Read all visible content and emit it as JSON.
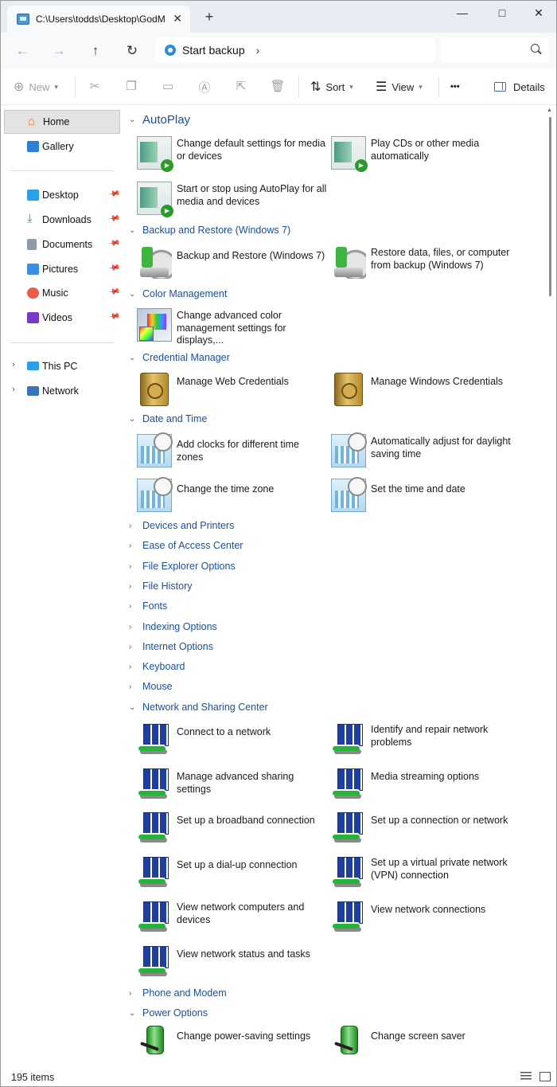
{
  "window": {
    "tab_title": "C:\\Users\\todds\\Desktop\\GodM",
    "minimize_glyph": "—",
    "maximize_glyph": "□",
    "close_glyph": "✕"
  },
  "address": {
    "location": "Start backup",
    "search_placeholder": ""
  },
  "commands": {
    "new_label": "New",
    "sort_label": "Sort",
    "view_label": "View",
    "more_label": "•••",
    "details_label": "Details"
  },
  "sidebar": {
    "items": [
      {
        "label": "Home"
      },
      {
        "label": "Gallery"
      },
      {
        "label": "Desktop"
      },
      {
        "label": "Downloads"
      },
      {
        "label": "Documents"
      },
      {
        "label": "Pictures"
      },
      {
        "label": "Music"
      },
      {
        "label": "Videos"
      },
      {
        "label": "This PC"
      },
      {
        "label": "Network"
      }
    ]
  },
  "groups": {
    "autoplay": {
      "title": "AutoPlay",
      "items": [
        "Change default settings for media or devices",
        "Play CDs or other media automatically",
        "Start or stop using AutoPlay for all media and devices"
      ]
    },
    "backup": {
      "title": "Backup and Restore (Windows 7)",
      "items": [
        "Backup and Restore (Windows 7)",
        "Restore data, files, or computer from backup (Windows 7)"
      ]
    },
    "color": {
      "title": "Color Management",
      "items": [
        "Change advanced color management settings for displays,..."
      ]
    },
    "credential": {
      "title": "Credential Manager",
      "items": [
        "Manage Web Credentials",
        "Manage Windows Credentials"
      ]
    },
    "datetime": {
      "title": "Date and Time",
      "items": [
        "Add clocks for different time zones",
        "Automatically adjust for daylight saving time",
        "Change the time zone",
        "Set the time and date"
      ]
    },
    "collapsed": [
      "Devices and Printers",
      "Ease of Access Center",
      "File Explorer Options",
      "File History",
      "Fonts",
      "Indexing Options",
      "Internet Options",
      "Keyboard",
      "Mouse"
    ],
    "network": {
      "title": "Network and Sharing Center",
      "items": [
        "Connect to a network",
        "Identify and repair network problems",
        "Manage advanced sharing settings",
        "Media streaming options",
        "Set up a broadband connection",
        "Set up a connection or network",
        "Set up a dial-up connection",
        "Set up a virtual private network (VPN) connection",
        "View network computers and devices",
        "View network connections",
        "View network status and tasks"
      ]
    },
    "phone": {
      "title": "Phone and Modem"
    },
    "power": {
      "title": "Power Options",
      "items": [
        "Change power-saving settings",
        "Change screen saver"
      ]
    }
  },
  "status": {
    "item_count": "195 items"
  }
}
